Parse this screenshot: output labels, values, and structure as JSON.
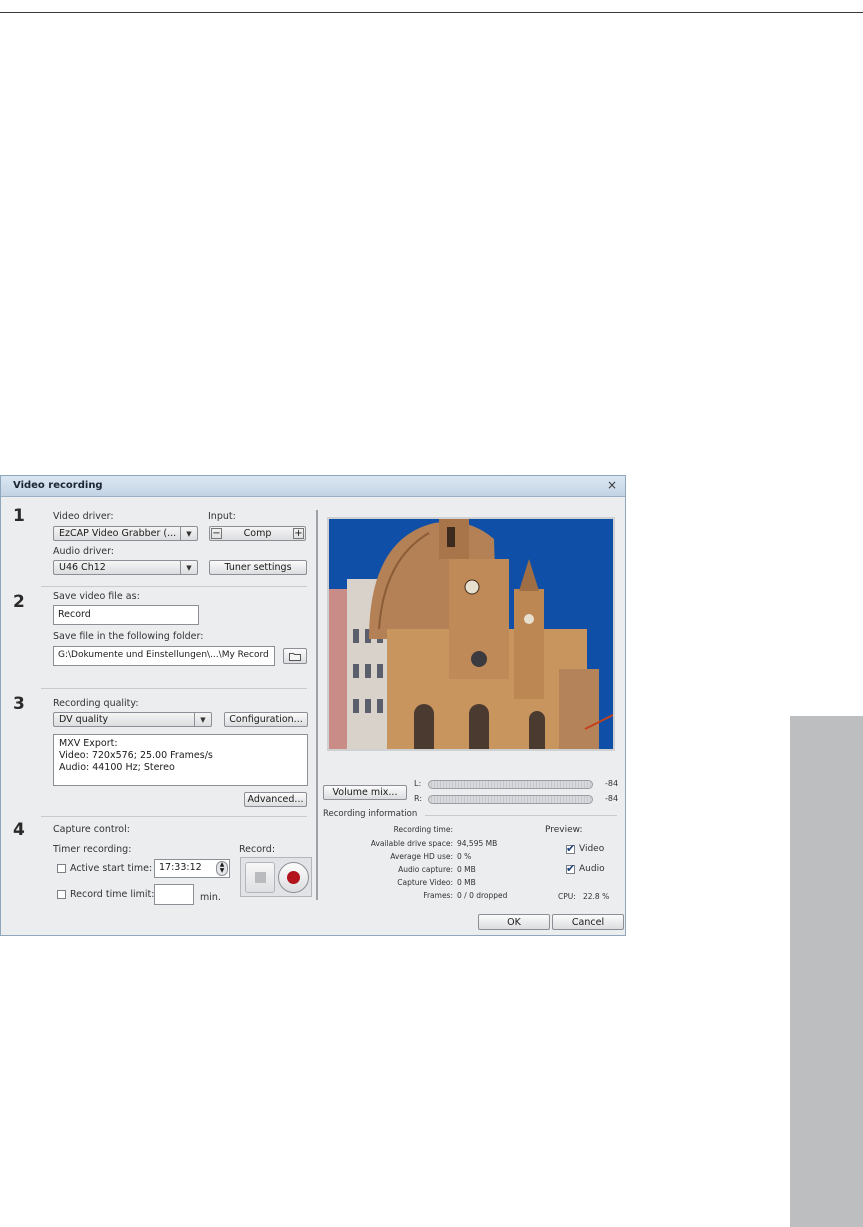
{
  "dialog": {
    "title": "Video recording",
    "close_glyph": "×"
  },
  "steps": [
    "1",
    "2",
    "3",
    "4"
  ],
  "section1": {
    "video_driver_label": "Video driver:",
    "video_driver_value": "EzCAP Video Grabber (...",
    "input_label": "Input:",
    "input_value": "Comp",
    "input_minus": "−",
    "input_plus": "+",
    "audio_driver_label": "Audio driver:",
    "audio_driver_value": "U46 Ch12",
    "tuner_settings": "Tuner settings"
  },
  "section2": {
    "save_as_label": "Save video file as:",
    "save_as_value": "Record",
    "folder_label": "Save file in the following folder:",
    "folder_value": "G:\\Dokumente und Einstellungen\\...\\My Record"
  },
  "section3": {
    "quality_label": "Recording quality:",
    "quality_value": "DV quality",
    "configuration": "Configuration...",
    "export_title": "MXV Export:",
    "export_video": "Video: 720x576; 25.00 Frames/s",
    "export_audio": "Audio: 44100 Hz; Stereo",
    "advanced": "Advanced..."
  },
  "section4": {
    "capture_control": "Capture control:",
    "timer_recording": "Timer recording:",
    "active_start_time": "Active start time:",
    "start_time_value": "17:33:12",
    "record_time_limit": "Record time limit:",
    "min_label": "min.",
    "record_label": "Record:"
  },
  "audio": {
    "volume_mix": "Volume mix...",
    "left_label": "L:",
    "right_label": "R:",
    "left_db": "-84",
    "right_db": "-84"
  },
  "recording_info": {
    "heading": "Recording information",
    "rows": [
      {
        "label": "Recording time:",
        "value": ""
      },
      {
        "label": "Available drive space:",
        "value": "94,595 MB"
      },
      {
        "label": "Average HD use:",
        "value": "0 %"
      },
      {
        "label": "Audio capture:",
        "value": "0 MB"
      },
      {
        "label": "Capture Video:",
        "value": "0 MB"
      },
      {
        "label": "Frames:",
        "value": "0 / 0 dropped"
      }
    ],
    "preview_label": "Preview:",
    "preview_video": "Video",
    "preview_audio": "Audio",
    "cpu_label": "CPU:",
    "cpu_value": "22.8 %"
  },
  "footer": {
    "ok": "OK",
    "cancel": "Cancel"
  },
  "colors": {
    "sky": "#0f4fa8",
    "stone": "#c9955f",
    "record_dot": "#b3131b"
  }
}
